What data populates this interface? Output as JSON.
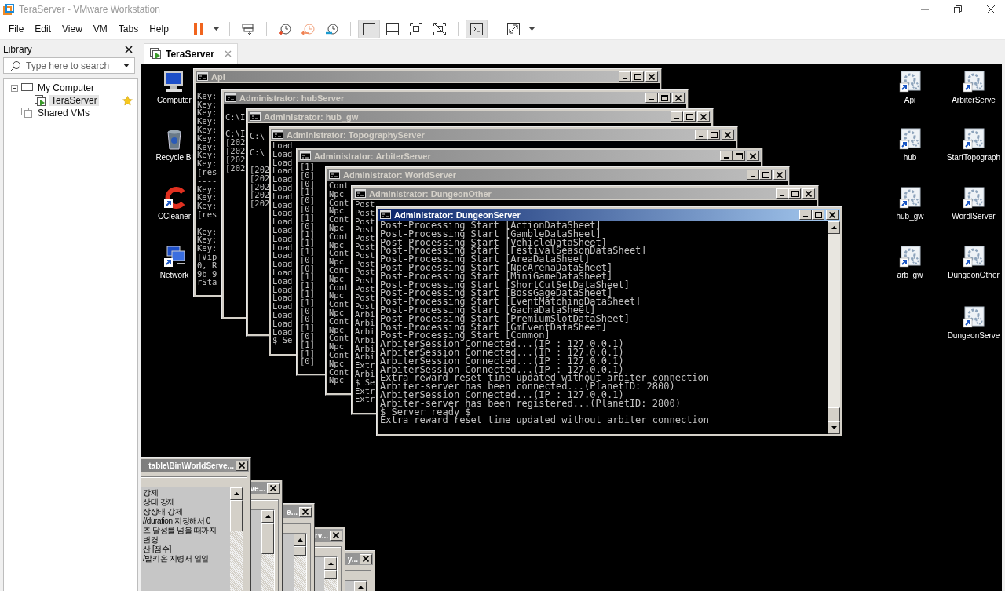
{
  "window": {
    "title": "TeraServer - VMware Workstation"
  },
  "menu": [
    {
      "label": "File"
    },
    {
      "label": "Edit"
    },
    {
      "label": "View"
    },
    {
      "label": "VM"
    },
    {
      "label": "Tabs"
    },
    {
      "label": "Help"
    }
  ],
  "toolbar": {
    "view_buttons": [
      {
        "kind": "sidebar",
        "selected": true
      },
      {
        "kind": "panel",
        "selected": false
      },
      {
        "kind": "fit",
        "selected": false
      },
      {
        "kind": "unfit",
        "selected": false
      }
    ],
    "console_button": {
      "selected": true
    }
  },
  "library": {
    "title": "Library",
    "search": {
      "placeholder": "Type here to search"
    },
    "tree": [
      {
        "label": "My Computer",
        "kind": "computer",
        "expanded": true,
        "selected": false,
        "children": [
          {
            "label": "TeraServer",
            "kind": "vm",
            "selected": true,
            "favorite": true
          }
        ]
      },
      {
        "label": "Shared VMs",
        "kind": "shared",
        "selected": false
      }
    ]
  },
  "tabs": [
    {
      "label": "TeraServer",
      "selected": true
    }
  ],
  "desktop_icons": [
    {
      "label": "Computer",
      "kind": "computer"
    },
    {
      "label": "Recycle Bi",
      "kind": "recycle-bin"
    },
    {
      "label": "CCleaner",
      "kind": "cleaner"
    },
    {
      "label": "Network",
      "kind": "network"
    },
    {
      "label": "Api",
      "kind": "shortcut"
    },
    {
      "label": "hub",
      "kind": "shortcut"
    },
    {
      "label": "hub_gw",
      "kind": "shortcut"
    },
    {
      "label": "arb_gw",
      "kind": "shortcut"
    },
    {
      "label": "ArbiterServe",
      "kind": "shortcut"
    },
    {
      "label": "StartTopograph",
      "kind": "shortcut"
    },
    {
      "label": "WordlServer",
      "kind": "shortcut"
    },
    {
      "label": "DungeonOther",
      "kind": "shortcut"
    },
    {
      "label": "DungeonServe",
      "kind": "shortcut"
    }
  ],
  "consoles": [
    {
      "title": "Api",
      "active": false,
      "lines": [
        "Key:",
        "Key:",
        "Key:",
        "Key:",
        "Key:",
        "Key:",
        "Key:",
        "Key:",
        "Key:",
        "[res",
        "----",
        "Key:",
        "Key:",
        "Key:",
        "[res",
        "----",
        "Key:",
        "Key:",
        "Key:",
        "[Vip",
        "0, R",
        "9b-9",
        "rSta"
      ]
    },
    {
      "title": "Administrator: hubServer",
      "active": false,
      "lines": [
        "C:\\I",
        "C:\\I",
        "[202",
        "[202",
        "[202",
        "[202"
      ]
    },
    {
      "title": "Administrator: hub_gw",
      "active": false,
      "lines": [
        "C:\\",
        "C:\\",
        "[202",
        "[202",
        "[202",
        "[202",
        "[202"
      ]
    },
    {
      "title": "Administrator: TopographyServer",
      "active": false,
      "lines": [
        "Load",
        "Load",
        "Load",
        "Load",
        "Load",
        "Load",
        "Load",
        "Load",
        "Load",
        "Load",
        "Load",
        "Load",
        "Load",
        "Load",
        "Load",
        "Load",
        "Load",
        "Load",
        "Load",
        "Load",
        "Load",
        "Load",
        "Load",
        "$ Se"
      ]
    },
    {
      "title": "Administrator: ArbiterServer",
      "active": false,
      "lines": [
        "[1]",
        "[0]",
        "[0]",
        "[1]",
        "[0]",
        "[0]",
        "[1]",
        "[0]",
        "[1]",
        "[1]",
        "[1]",
        "[0]",
        "[0]",
        "[1]",
        "[1]",
        "[1]",
        "[1]",
        "[0]",
        "[0]",
        "[1]",
        "[0]",
        "[1]",
        "[1]",
        "[0]"
      ]
    },
    {
      "title": "Administrator: WorldServer",
      "active": false,
      "lines": [
        "Cont",
        "Npc",
        "Cont",
        "Npc",
        "Cont",
        "Npc",
        "Cont",
        "Npc",
        "Cont",
        "Npc",
        "Cont",
        "Npc",
        "Cont",
        "Npc",
        "Cont",
        "Npc",
        "Cont",
        "Npc",
        "Cont",
        "Npc",
        "Cont",
        "Npc",
        "Cont",
        "Npc"
      ]
    },
    {
      "title": "Administrator: DungeonOther",
      "active": false,
      "lines": [
        "Post",
        "Post",
        "Post",
        "Post",
        "Post",
        "Post",
        "Post",
        "Post",
        "Post",
        "Post",
        "Post",
        "Post",
        "Post",
        "Arbi",
        "Arbi",
        "Arbi",
        "Arbi",
        "Arbi",
        "Arbi",
        "Extr",
        "Arbi",
        "$ Se",
        "Extr",
        "Extr"
      ]
    },
    {
      "title": "Administrator: DungeonServer",
      "active": true,
      "lines": [
        "Post-Processing Start [ActionDataSheet]",
        "Post-Processing Start [GambleDataSheet]",
        "Post-Processing Start [VehicleDataSheet]",
        "Post-Processing Start [FestivalSeasonDataSheet]",
        "Post-Processing Start [AreaDataSheet]",
        "Post-Processing Start [NpcArenaDataSheet]",
        "Post-Processing Start [MiniGameDataSheet]",
        "Post-Processing Start [ShortCutSetDataSheet]",
        "Post-Processing Start [BossGageDataSheet]",
        "Post-Processing Start [EventMatchingDataSheet]",
        "Post-Processing Start [GachaDataSheet]",
        "Post-Processing Start [PremiumSlotDataSheet]",
        "Post-Processing Start [GmEventDataSheet]",
        "Post-Processing Start [Common]",
        "ArbiterSession Connected...(IP : 127.0.0.1)",
        "ArbiterSession Connected...(IP : 127.0.0.1)",
        "ArbiterSession Connected...(IP : 127.0.0.1)",
        "ArbiterSession Connected...(IP : 127.0.0.1)",
        "Extra reward reset time updated without arbiter connection",
        "Arbiter-server has been connected...(PlanetID: 2800)",
        "ArbiterSession Connected...(IP : 127.0.0.1)",
        "Arbiter-server has been registered...(PlanetID: 2800)",
        "$ Server ready $",
        "Extra reward reset time updated without arbiter connection"
      ]
    }
  ],
  "dialogs": [
    {
      "title": "table\\Bin\\WorldServe...",
      "active": false,
      "items": [
        "강제",
        "상태 강제",
        "상상태 강제",
        "//duration 지정해서 0",
        "즈 달성률 넘을 때까지",
        "변경",
        "산 [점수]",
        "/발키온 지령서 일일"
      ]
    },
    {
      "title": "ve...",
      "active": false
    },
    {
      "title": "e...",
      "active": false
    },
    {
      "title": "rv...",
      "active": false
    },
    {
      "title": "y...",
      "active": false
    }
  ]
}
